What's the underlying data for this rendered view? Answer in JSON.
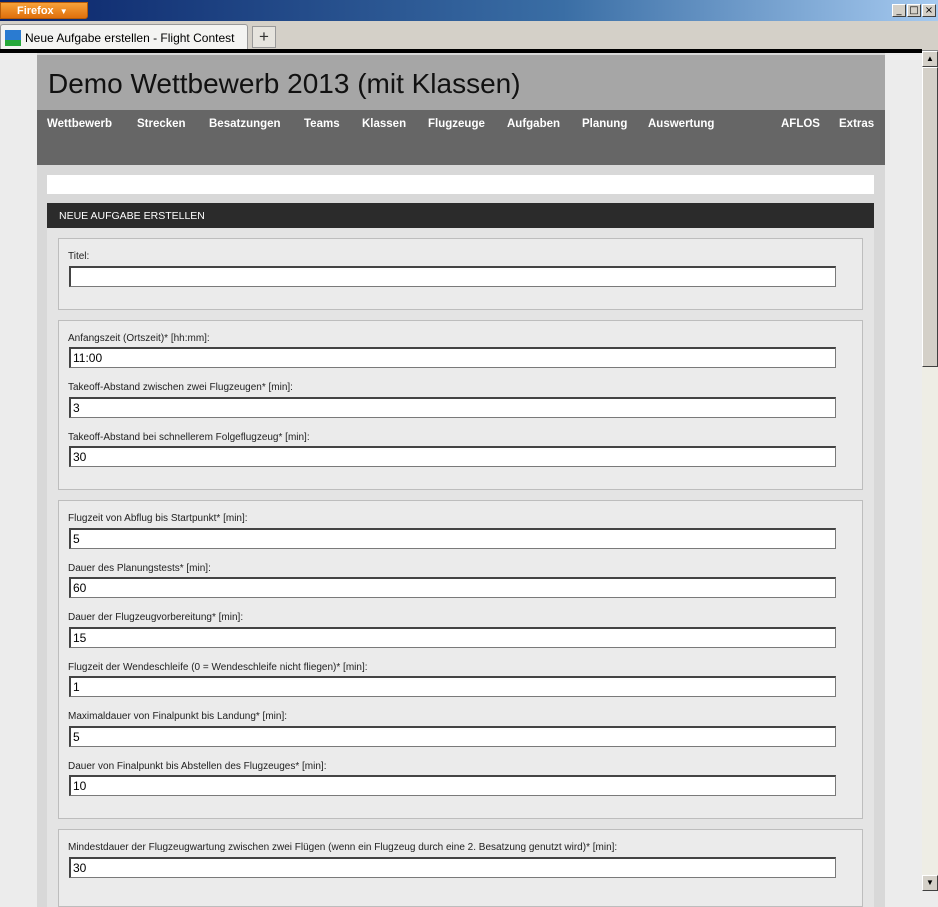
{
  "browser": {
    "app_button": "Firefox",
    "tab_title": "Neue Aufgabe erstellen - Flight Contest",
    "new_tab": "+",
    "window_controls": [
      "_",
      "□",
      "×"
    ]
  },
  "header": {
    "title": "Demo Wettbewerb 2013 (mit Klassen)"
  },
  "nav": {
    "items": [
      "Wettbewerb",
      "Strecken",
      "Besatzungen",
      "Teams",
      "Klassen",
      "Flugzeuge",
      "Aufgaben",
      "Planung",
      "Auswertung",
      "AFLOS",
      "Extras"
    ]
  },
  "section": {
    "title": "NEUE AUFGABE ERSTELLEN"
  },
  "fields": [
    {
      "label": "Titel:",
      "value": ""
    },
    {
      "label": "Anfangszeit (Ortszeit)* [hh:mm]:",
      "value": "11:00"
    },
    {
      "label": "Takeoff-Abstand zwischen zwei Flugzeugen* [min]:",
      "value": "3"
    },
    {
      "label": "Takeoff-Abstand bei schnellerem Folgeflugzeug* [min]:",
      "value": "30"
    },
    {
      "label": "Flugzeit von Abflug bis Startpunkt* [min]:",
      "value": "5"
    },
    {
      "label": "Dauer des Planungstests* [min]:",
      "value": "60"
    },
    {
      "label": "Dauer der Flugzeugvorbereitung* [min]:",
      "value": "15"
    },
    {
      "label": "Flugzeit der Wendeschleife (0 = Wendeschleife nicht fliegen)* [min]:",
      "value": "1"
    },
    {
      "label": "Maximaldauer von Finalpunkt bis Landung* [min]:",
      "value": "5"
    },
    {
      "label": "Dauer von Finalpunkt bis Abstellen des Flugzeuges* [min]:",
      "value": "10"
    },
    {
      "label": "Mindestdauer der Flugzeugwartung zwischen zwei Flügen (wenn ein Flugzeug durch eine 2. Besatzung genutzt wird)* [min]:",
      "value": "30"
    }
  ]
}
